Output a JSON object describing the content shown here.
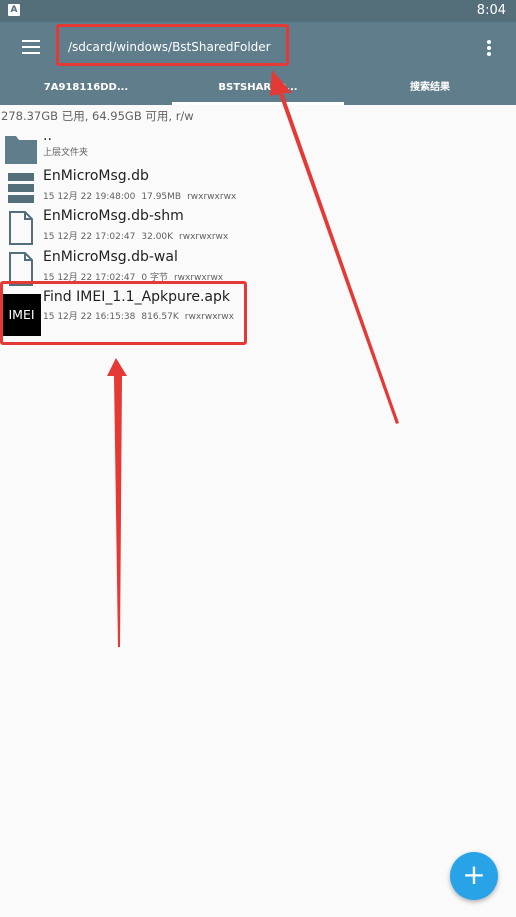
{
  "status_bar": {
    "badge": "A",
    "clock": "8:04"
  },
  "toolbar": {
    "path": "/sdcard/windows/BstSharedFolder"
  },
  "tabs": [
    {
      "label": "7A918116DD..."
    },
    {
      "label": "BSTSHARED..."
    },
    {
      "label": "搜索结果"
    }
  ],
  "storage_info": "278.37GB 已用, 64.95GB 可用, r/w",
  "files": [
    {
      "name": "..",
      "date": "上层文件夹",
      "size": "",
      "perms": "",
      "icon": "folder-icon"
    },
    {
      "name": "EnMicroMsg.db",
      "date": "15 12月 22 19:48:00",
      "size": "17.95MB",
      "perms": "rwxrwxrwx",
      "icon": "database-icon"
    },
    {
      "name": "EnMicroMsg.db-shm",
      "date": "15 12月 22 17:02:47",
      "size": "32.00K",
      "perms": "rwxrwxrwx",
      "icon": "file-icon"
    },
    {
      "name": "EnMicroMsg.db-wal",
      "date": "15 12月 22 17:02:47",
      "size": "0 字节",
      "perms": "rwxrwxrwx",
      "icon": "file-icon"
    },
    {
      "name": "Find IMEI_1.1_Apkpure.apk",
      "date": "15 12月 22 16:15:38",
      "size": "816.57K",
      "perms": "rwxrwxrwx",
      "icon": "apk-thumbnail",
      "thumb_text": "IMEI"
    }
  ],
  "fab": {
    "label": "+"
  },
  "colors": {
    "toolbar": "#607d8b",
    "status_bar": "#546e7a",
    "fab": "#29a3e8",
    "highlight": "#e53935"
  }
}
